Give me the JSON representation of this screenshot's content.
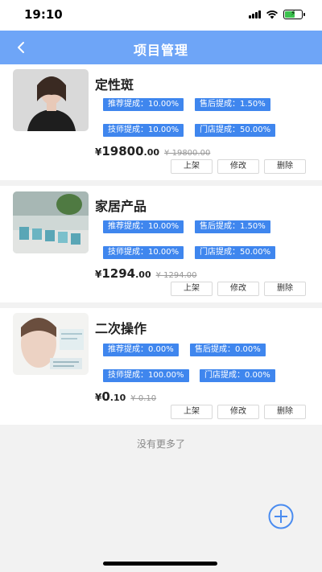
{
  "status_bar": {
    "time": "19:10",
    "icons": [
      "signal-icon",
      "wifi-icon",
      "battery-charging-icon"
    ]
  },
  "nav": {
    "title": "项目管理",
    "back_icon": "chevron-left-icon"
  },
  "items": [
    {
      "title": "定性斑",
      "tags": {
        "recommend": "推荐提成：10.00%",
        "after_sale": "售后提成：1.50%",
        "technician": "技师提成：10.00%",
        "store": "门店提成：50.00%"
      },
      "price": {
        "symbol": "¥",
        "int": "19800",
        "dec": ".00",
        "old": "¥ 19800.00"
      },
      "actions": {
        "list": "上架",
        "edit": "修改",
        "delete": "删除"
      }
    },
    {
      "title": "家居产品",
      "tags": {
        "recommend": "推荐提成：10.00%",
        "after_sale": "售后提成：1.50%",
        "technician": "技师提成：10.00%",
        "store": "门店提成：50.00%"
      },
      "price": {
        "symbol": "¥",
        "int": "1294",
        "dec": ".00",
        "old": "¥ 1294.00"
      },
      "actions": {
        "list": "上架",
        "edit": "修改",
        "delete": "删除"
      }
    },
    {
      "title": "二次操作",
      "tags": {
        "recommend": "推荐提成：0.00%",
        "after_sale": "售后提成：0.00%",
        "technician": "技师提成：100.00%",
        "store": "门店提成：0.00%"
      },
      "price": {
        "symbol": "¥",
        "int": "0",
        "dec": ".10",
        "old": "¥ 0.10"
      },
      "actions": {
        "list": "上架",
        "edit": "修改",
        "delete": "删除"
      }
    }
  ],
  "footer": {
    "no_more": "没有更多了",
    "add_icon": "plus-circle-icon"
  },
  "colors": {
    "nav_bg": "#6ea5f7",
    "tag_bg": "#3f86ee",
    "page_bg": "#f2f2f2"
  }
}
